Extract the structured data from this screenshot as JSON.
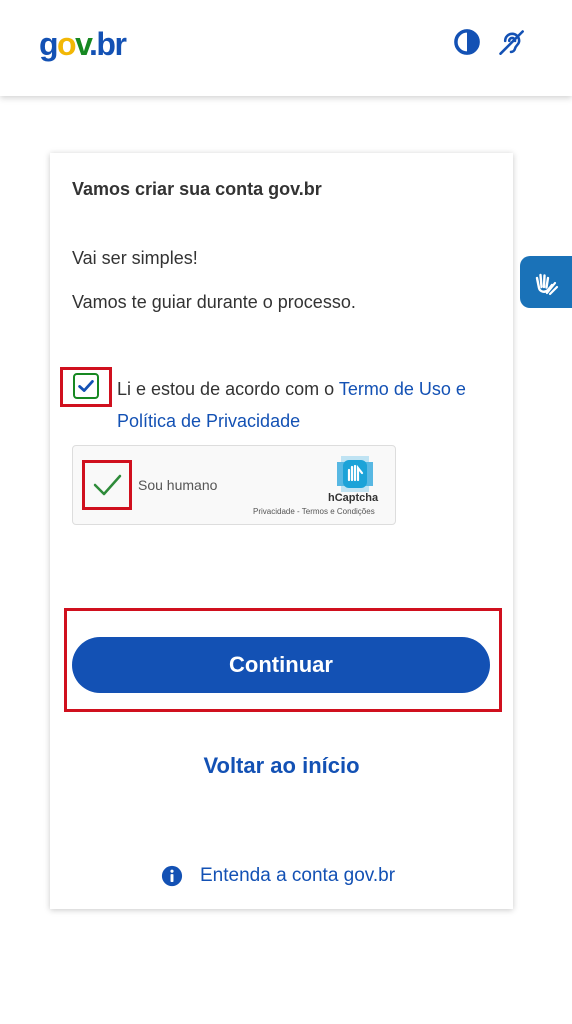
{
  "header": {
    "logo": {
      "part1": "g",
      "part2": "o",
      "part3": "v",
      "part4": ".br"
    },
    "icons": [
      "contrast-icon",
      "accessibility-icon"
    ]
  },
  "card": {
    "title": "Vamos criar sua conta gov.br",
    "intro1": "Vai ser simples!",
    "intro2": "Vamos te guiar durante o processo.",
    "terms": {
      "checked": true,
      "prefix": "Li e estou de acordo com o ",
      "link": "Termo de Uso e Política de Privacidade"
    },
    "captcha": {
      "label": "Sou humano",
      "brand": "hCaptcha",
      "links": "Privacidade - Termos e Condições",
      "checked": true
    },
    "continue_label": "Continuar",
    "back_label": "Voltar ao início",
    "info_label": "Entenda a conta gov.br"
  },
  "colors": {
    "primary": "#1351b4",
    "highlight": "#d0101e",
    "success": "#168821",
    "vlibras": "#1a72b8"
  },
  "floating": {
    "icon": "sign-language-icon"
  }
}
